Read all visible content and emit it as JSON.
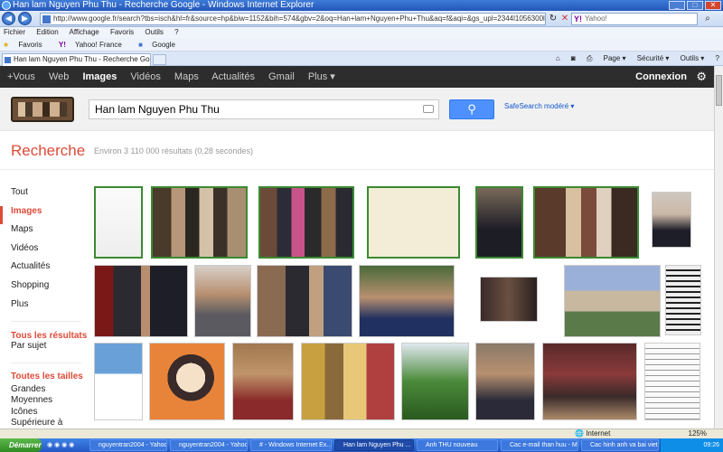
{
  "window": {
    "title": "Han lam Nguyen Phu Thu - Recherche Google - Windows Internet Explorer"
  },
  "addressbar": {
    "url": "http://www.google.fr/search?tbs=isch&hl=fr&source=hp&biw=1152&bih=574&gbv=2&oq=Han+lam+Nguyen+Phu+Thu&aq=f&aqi=&gs_upl=2344l1056300l2516l2323l30l17l0l14l593l2..4l606lq",
    "search_engine_label": "Yahoo!"
  },
  "menu": [
    "Fichier",
    "Edition",
    "Affichage",
    "Favoris",
    "Outils",
    "?"
  ],
  "favorites": {
    "label": "Favoris",
    "items": [
      "Yahoo! France",
      "Google"
    ]
  },
  "tab": {
    "title": "Han lam Nguyen Phu Thu - Recherche Google"
  },
  "commandbar": [
    "Page ▾",
    "Sécurité ▾",
    "Outils ▾"
  ],
  "googlebar": {
    "links": [
      "+Vous",
      "Web",
      "Images",
      "Vidéos",
      "Maps",
      "Actualités",
      "Gmail",
      "Plus ▾"
    ],
    "selected": "Images",
    "signin": "Connexion"
  },
  "search": {
    "query": "Han lam Nguyen Phu Thu",
    "safesearch": "SafeSearch modéré ▾"
  },
  "results": {
    "heading": "Recherche",
    "stats": "Environ 3 110 000 résultats (0,28 secondes)"
  },
  "leftnav": {
    "items": [
      "Tout",
      "Images",
      "Maps",
      "Vidéos",
      "Actualités",
      "Shopping",
      "Plus"
    ],
    "selected": "Images",
    "all_results": {
      "head": "Tous les résultats",
      "sub": "Par sujet"
    },
    "sizes": {
      "head": "Toutes les tailles",
      "options": [
        "Grandes",
        "Moyennes",
        "Icônes",
        "Supérieure à"
      ]
    }
  },
  "statusbar": {
    "zone": "Internet",
    "zoom": "125%"
  },
  "taskbar": {
    "start": "Démarrer",
    "tasks": [
      "nguyentran2004 - Yahoo...",
      "nguyentran2004 - Yahoo...",
      "# - Windows Internet Ex...",
      "Han lam Nguyen Phu ...",
      "Anh THU nouveau",
      "Cac e-mail than huu - Mic...",
      "Cac hinh anh va bai viet ..."
    ],
    "active_task": 3,
    "clock": "09:26"
  },
  "colors": {
    "accent_red": "#dd4b39",
    "button_blue": "#4d90fe",
    "gbar_bg": "#2d2d2d",
    "thumb_border_green": "#3b8a32"
  }
}
